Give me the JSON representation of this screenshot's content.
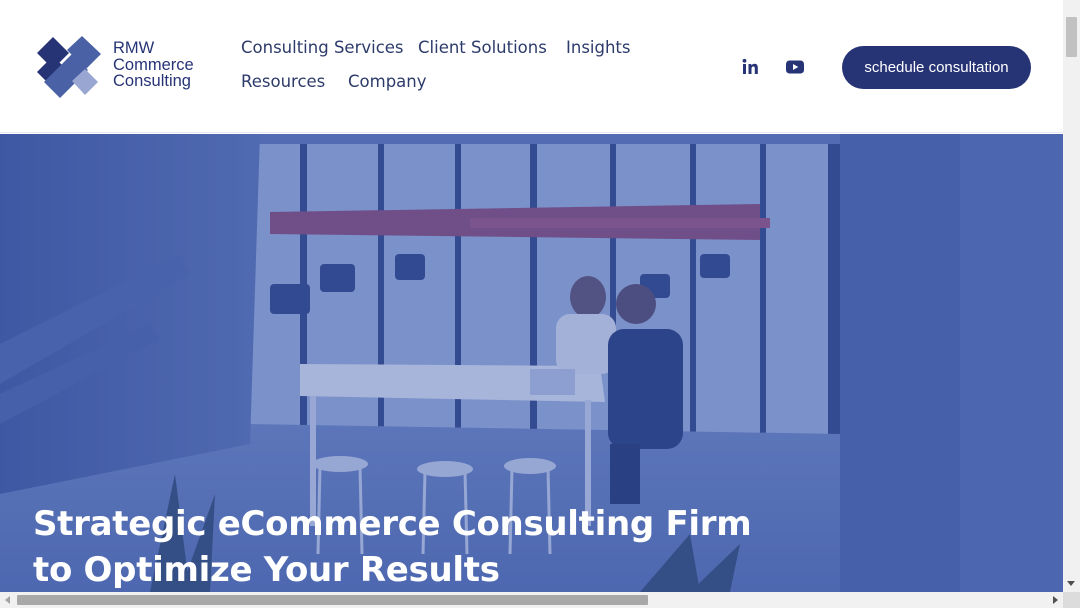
{
  "brand": {
    "name_lines": [
      "RMW",
      "Commerce",
      "Consulting"
    ],
    "logo_icon": "diamond-stack-logo-icon",
    "colors": {
      "primary": "#263476",
      "secondary": "#4a61a6",
      "light": "#9aa6d2"
    }
  },
  "nav": {
    "items": [
      {
        "label": "Consulting Services"
      },
      {
        "label": "Client Solutions"
      },
      {
        "label": "Insights"
      },
      {
        "label": "Resources"
      },
      {
        "label": "Company"
      }
    ]
  },
  "social": {
    "linkedin_icon": "linkedin-icon",
    "youtube_icon": "youtube-icon"
  },
  "cta": {
    "label": "schedule consultation"
  },
  "hero": {
    "title_lines": [
      "Strategic eCommerce Consulting Firm",
      "to Optimize Your Results"
    ],
    "overlay_color": "#3f5aa8"
  }
}
